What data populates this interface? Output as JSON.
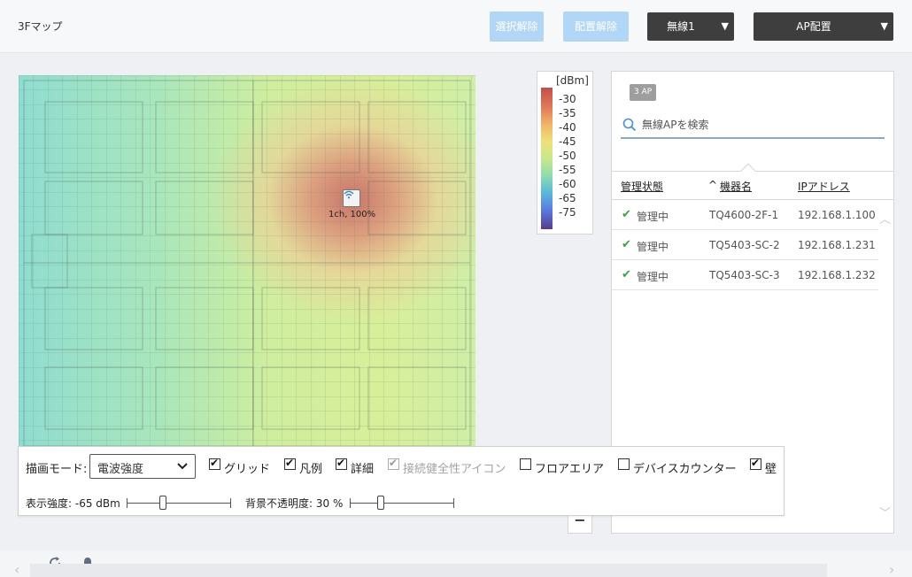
{
  "header": {
    "title": "3Fマップ",
    "deselect_label": "選択解除",
    "unplace_label": "配置解除",
    "wireless_select": "無線1",
    "ap_place_select": "AP配置"
  },
  "map": {
    "ap_marker_label": "1ch, 100%"
  },
  "legend": {
    "unit": "[dBm]",
    "ticks": [
      "-30",
      "-35",
      "-40",
      "-45",
      "-50",
      "-55",
      "-60",
      "-65",
      "-75"
    ]
  },
  "panel": {
    "count_badge": "3 AP",
    "search_placeholder": "無線APを検索",
    "columns": {
      "status": "管理状態",
      "device": "機器名",
      "ip": "IPアドレス"
    },
    "sort_indicator": "^",
    "rows": [
      {
        "status": "管理中",
        "device": "TQ4600-2F-1",
        "ip": "192.168.1.100"
      },
      {
        "status": "管理中",
        "device": "TQ5403-SC-2",
        "ip": "192.168.1.231"
      },
      {
        "status": "管理中",
        "device": "TQ5403-SC-3",
        "ip": "192.168.1.232"
      }
    ]
  },
  "controls": {
    "draw_mode_label": "描画モード:",
    "draw_mode_value": "電波強度",
    "grid_label": "グリッド",
    "grid_checked": true,
    "legend_label": "凡例",
    "legend_checked": true,
    "detail_label": "詳細",
    "detail_checked": true,
    "health_icon_label": "接続健全性アイコン",
    "health_icon_checked": true,
    "floor_area_label": "フロアエリア",
    "floor_area_checked": false,
    "device_counter_label": "デバイスカウンター",
    "device_counter_checked": false,
    "wall_label": "壁",
    "wall_checked": true,
    "strength_label": "表示強度: -65 dBm",
    "strength_level": 0.35,
    "opacity_label": "背景不透明度: 30 %",
    "opacity_level": 0.3
  },
  "zoom_out": "−",
  "colors": {
    "accent_light": "#b2d6f5",
    "dark_button": "#3e3e3e",
    "status_ok": "#3aa04a"
  }
}
